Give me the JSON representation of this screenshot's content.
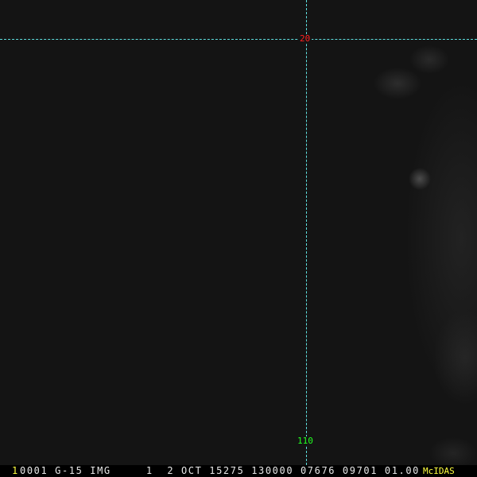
{
  "image": {
    "description_free": true
  },
  "grid": {
    "line_color": "#5fe0e0",
    "lat_label": "20",
    "lat_color": "#ff2020",
    "lon_label": "110",
    "lon_color": "#20ff20"
  },
  "status_bar": {
    "frame_number": "1",
    "info": "0001 G-15 IMG     1  2 OCT 15275 130000 07676 09701 01.00",
    "brand": "McIDAS"
  }
}
